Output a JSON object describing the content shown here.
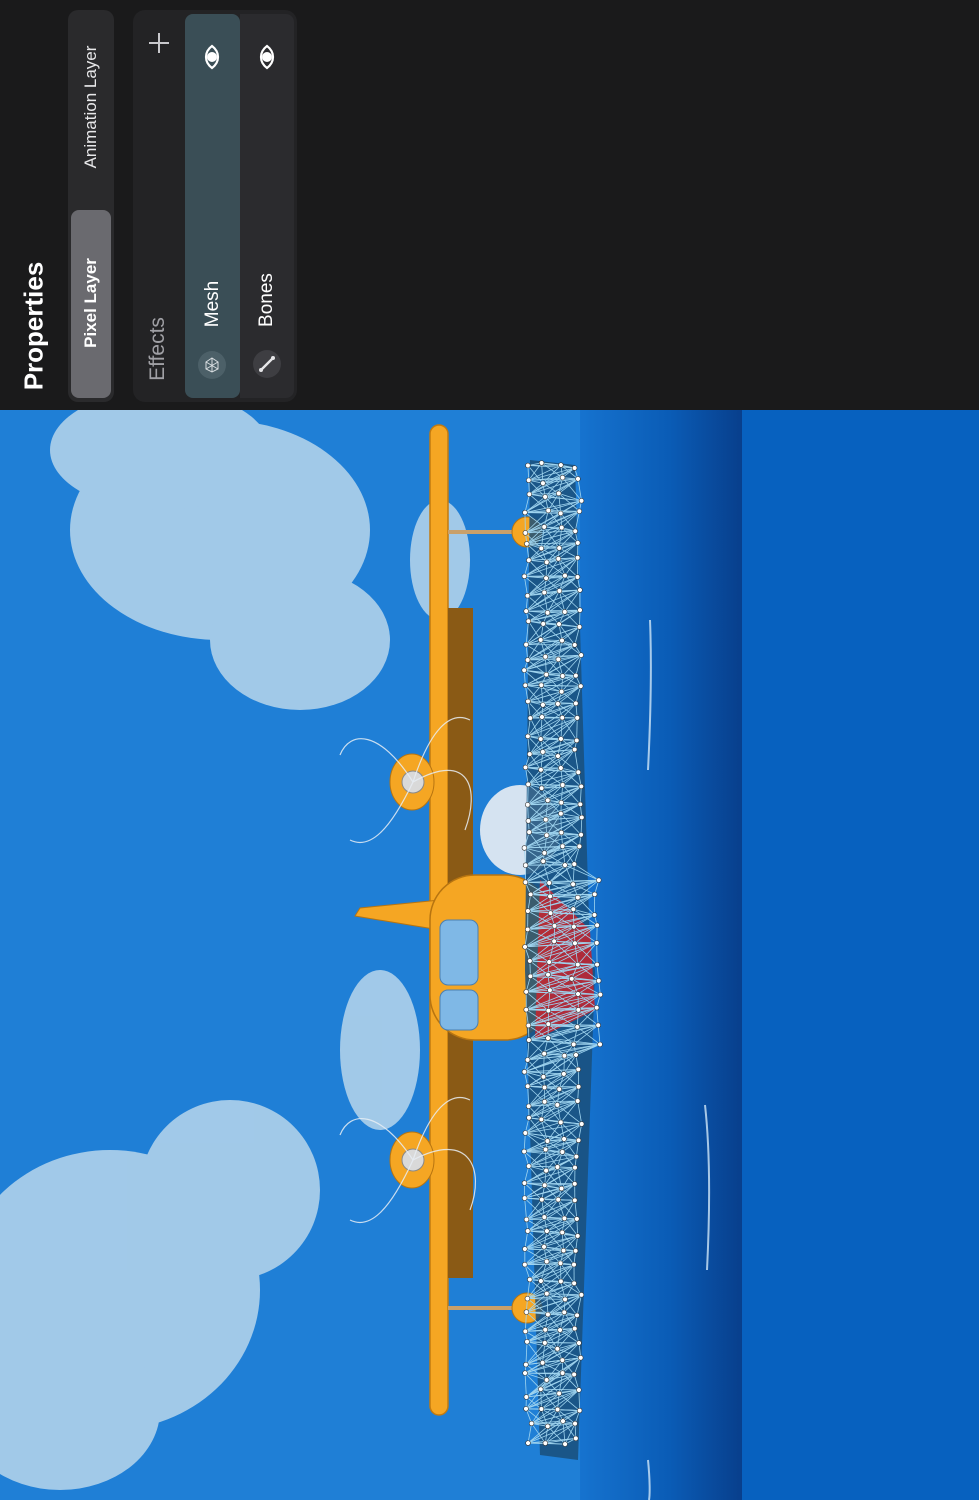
{
  "panel": {
    "title": "Properties",
    "layer_types": [
      {
        "label": "Pixel Layer",
        "selected": true
      },
      {
        "label": "Animation Layer",
        "selected": false
      }
    ],
    "effects": {
      "label": "Effects",
      "add_icon": "plus-icon",
      "items": [
        {
          "label": "Mesh",
          "icon": "mesh-icon",
          "visible": true,
          "selected": true
        },
        {
          "label": "Bones",
          "icon": "bone-icon",
          "visible": true,
          "selected": false
        }
      ]
    }
  },
  "canvas": {
    "subject": "seaplane-illustration",
    "colors": {
      "sky": "#1f7fd6",
      "sea": "#0b5fb8",
      "mesh": "#9fd4ef",
      "plane": "#f5a623"
    }
  }
}
